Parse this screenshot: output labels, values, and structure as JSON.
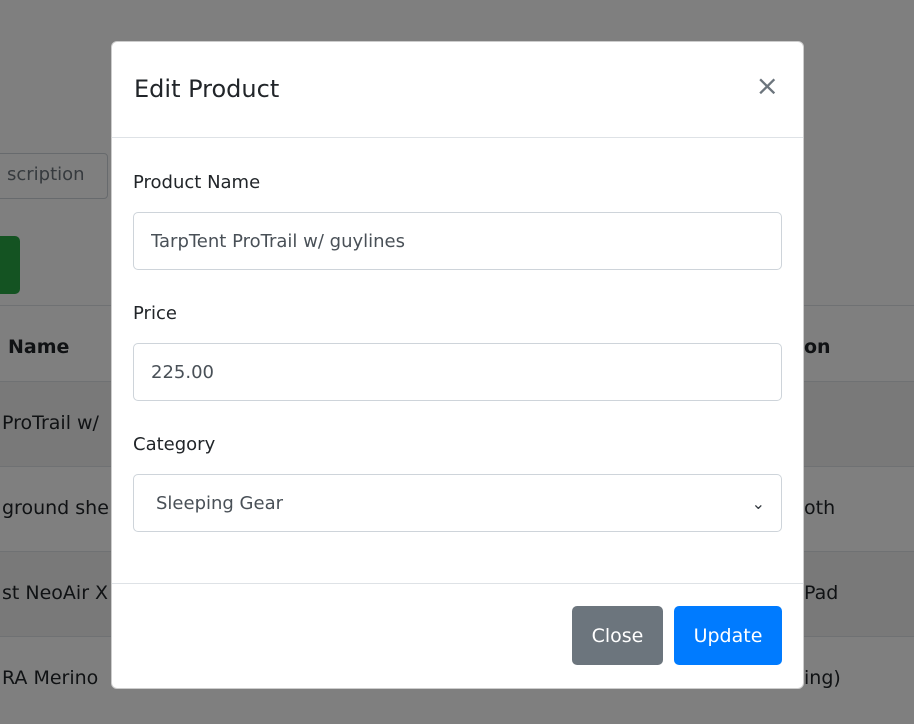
{
  "background": {
    "search_text": "scription",
    "table": {
      "header_left": "Name",
      "header_right": "on",
      "rows": [
        {
          "left": "ProTrail w/",
          "right": ""
        },
        {
          "left": "ground she",
          "right": "oth"
        },
        {
          "left": "st NeoAir X",
          "right": "Pad"
        },
        {
          "left": "RA Merino",
          "right": "ing)"
        }
      ]
    }
  },
  "modal": {
    "title": "Edit Product",
    "close_icon": "×",
    "fields": {
      "name_label": "Product Name",
      "name_value": "TarpTent ProTrail w/ guylines",
      "price_label": "Price",
      "price_value": "225.00",
      "category_label": "Category",
      "category_value": "Sleeping Gear",
      "category_chevron": "⌄"
    },
    "buttons": {
      "close": "Close",
      "update": "Update"
    }
  },
  "colors": {
    "primary": "#007bff",
    "secondary": "#6c757d",
    "success": "#28a745"
  }
}
